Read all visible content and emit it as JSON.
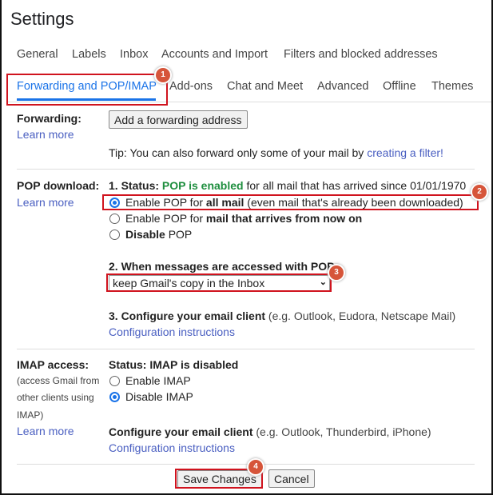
{
  "title": "Settings",
  "tabs_row1": [
    "General",
    "Labels",
    "Inbox",
    "Accounts and Import",
    "Filters and blocked addresses"
  ],
  "tabs_row2": [
    "Forwarding and POP/IMAP",
    "Add-ons",
    "Chat and Meet",
    "Advanced",
    "Offline",
    "Themes"
  ],
  "active_tab": "Forwarding and POP/IMAP",
  "forwarding": {
    "label": "Forwarding:",
    "learn_more": "Learn more",
    "add_button": "Add a forwarding address",
    "tip_prefix": "Tip: You can also forward only some of your mail by ",
    "tip_link": "creating a filter!"
  },
  "pop": {
    "label": "POP download:",
    "learn_more": "Learn more",
    "status_prefix": "1. Status: ",
    "status_value": "POP is enabled",
    "status_suffix": " for all mail that has arrived since 01/01/1970",
    "options": [
      {
        "pre": "Enable POP for ",
        "bold": "all mail",
        "post": " (even mail that's already been downloaded)",
        "selected": true
      },
      {
        "pre": "Enable POP for ",
        "bold": "mail that arrives from now on",
        "post": "",
        "selected": false
      },
      {
        "pre": "",
        "bold": "Disable",
        "post": " POP",
        "selected": false
      }
    ],
    "access_heading": "2. When messages are accessed with POP",
    "access_select": "keep Gmail's copy in the Inbox",
    "configure_bold": "3. Configure your email client",
    "configure_rest": " (e.g. Outlook, Eudora, Netscape Mail)",
    "config_link": "Configuration instructions"
  },
  "imap": {
    "label": "IMAP access:",
    "sub1": "(access Gmail from",
    "sub2": "other clients using",
    "sub3": "IMAP)",
    "learn_more": "Learn more",
    "status": "Status: IMAP is disabled",
    "options": [
      {
        "label": "Enable IMAP",
        "selected": false
      },
      {
        "label": "Disable IMAP",
        "selected": true
      }
    ],
    "configure_bold": "Configure your email client",
    "configure_rest": " (e.g. Outlook, Thunderbird, iPhone)",
    "config_link": "Configuration instructions"
  },
  "footer": {
    "save": "Save Changes",
    "cancel": "Cancel"
  },
  "annotations": [
    "1",
    "2",
    "3",
    "4"
  ],
  "colors": {
    "accent": "#1a73e8",
    "status_green": "#1e8e3e",
    "annotation_red": "#d0131e",
    "badge": "#d6553a",
    "link": "#4a5fc1"
  }
}
